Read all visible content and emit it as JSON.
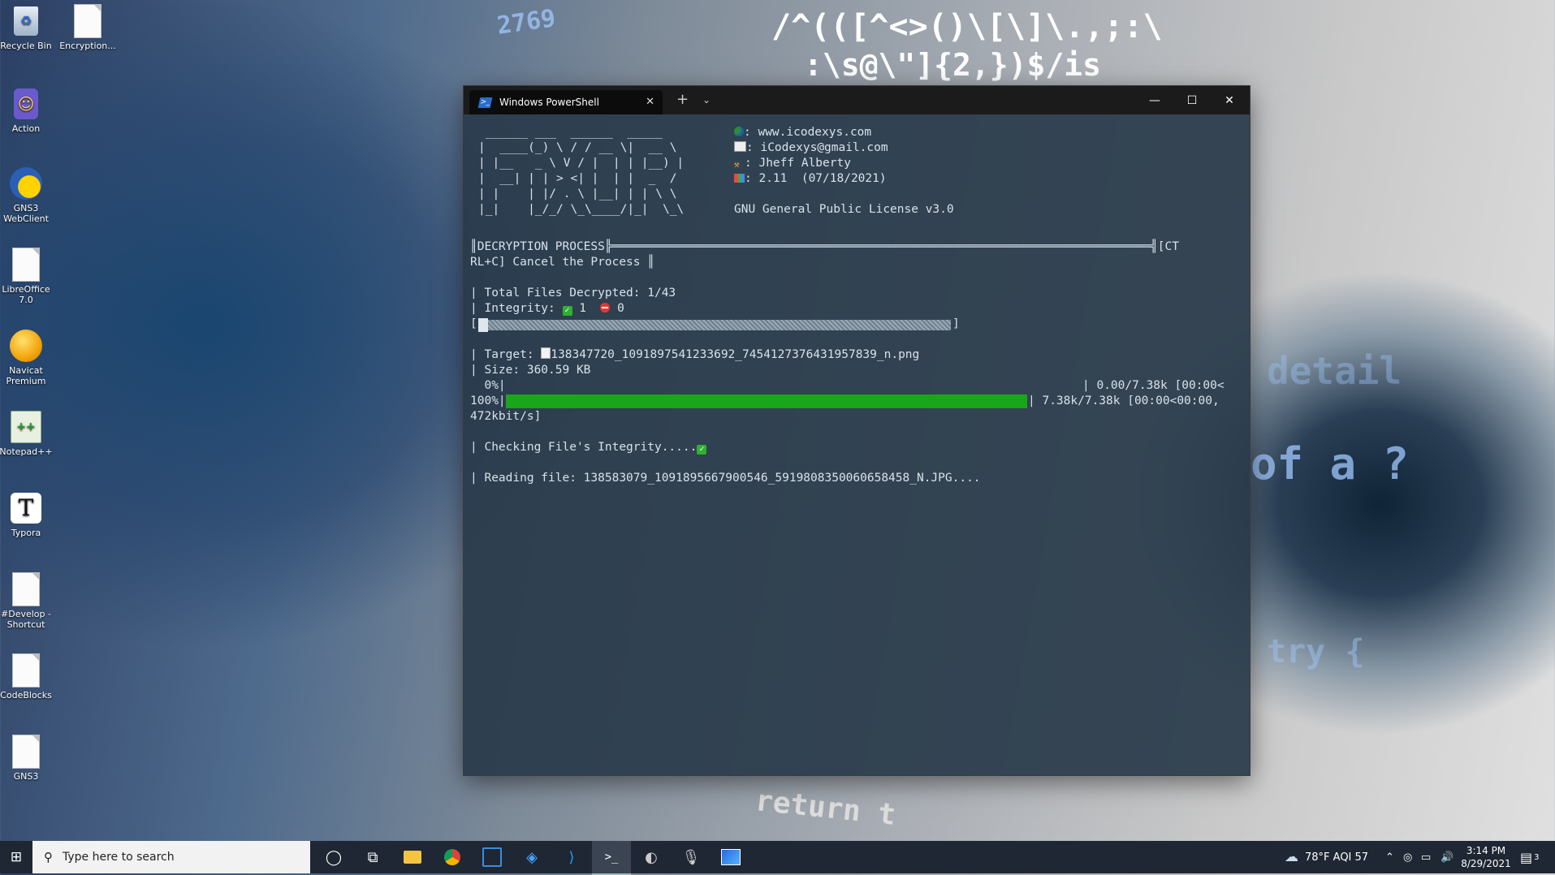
{
  "wallpaper_text": {
    "line1": "2769",
    "line2": "/^(([^<>()\\[\\]\\.,;:\\",
    "line3": ":\\s@\\\"]{2,})$/is",
    "line4": "return t",
    "line5": "of a ? ",
    "line6": "detail",
    "line7": "try {"
  },
  "desktop_icons": [
    {
      "label": "Recycle Bin"
    },
    {
      "label": "Encryption..."
    },
    {
      "label": "Action"
    },
    {
      "label": "GNS3 WebClient"
    },
    {
      "label": "LibreOffice 7.0"
    },
    {
      "label": "Navicat Premium"
    },
    {
      "label": "Notepad++"
    },
    {
      "label": "Typora"
    },
    {
      "label": "#Develop - Shortcut"
    },
    {
      "label": "CodeBlocks"
    },
    {
      "label": "GNS3"
    }
  ],
  "window": {
    "tab_title": "Windows PowerShell",
    "minimize": "—",
    "maximize": "☐",
    "close": "✕",
    "new_tab": "+",
    "dropdown": "⌄"
  },
  "terminal": {
    "ascii_art": [
      " ______ ___  ______  _____ ",
      "|  ____(_) \\ / / __ \\|  __ \\",
      "| |__   _ \\ V / |  | | |__) |",
      "|  __| | | > <| |  | |  _  /",
      "| |    | |/ . \\ |__| | | \\ \\",
      "|_|    |_/_/ \\_\\____/|_|  \\_\\"
    ],
    "info": {
      "website": ": www.icodexys.com",
      "email": ": iCodexys@gmail.com",
      "author": ": Jheff Alberty",
      "version": ": 2.11  (07/18/2021)",
      "license": "GNU General Public License v3.0"
    },
    "process_header_1": "║DECRYPTION PROCESS╠════════════════════════════════════════════════════════════════════════════╣[CT",
    "process_header_2": "RL+C] Cancel the Process ║",
    "total_files": "| Total Files Decrypted: 1/43",
    "integrity_label": "| Integrity: ",
    "integrity_ok": "1",
    "integrity_fail": "0",
    "overall_open": "[",
    "overall_close": "]",
    "overall_progress": 0.02,
    "target": "| Target: ",
    "target_file": "138347720_1091897541233692_7454127376431957839_n.png",
    "size": "| Size: 360.59 KB",
    "p0_left": "  0%|",
    "p0_right": "| 0.00/7.38k [00:00<",
    "p100_left": "100%|",
    "p100_right": "| 7.38k/7.38k [00:00<00:00,",
    "rate": "472kbit/s]",
    "file_progress": 1.0,
    "checking": "| Checking File's Integrity.....",
    "reading": "| Reading file: 138583079_1091895667900546_5919808350060658458_N.JPG...."
  },
  "taskbar": {
    "search_placeholder": "Type here to search",
    "weather": "78°F  AQI 57",
    "time": "3:14 PM",
    "date": "8/29/2021",
    "notifications": "3"
  }
}
